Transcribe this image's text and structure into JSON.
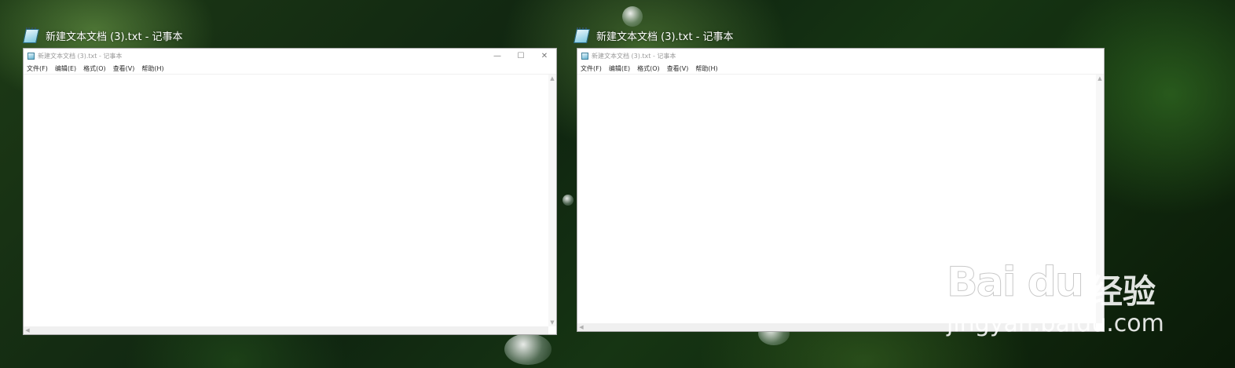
{
  "thumbnails": [
    {
      "title": "新建文本文档 (3).txt - 记事本"
    },
    {
      "title": "新建文本文档 (3).txt - 记事本"
    }
  ],
  "windows": [
    {
      "title": "新建文本文档 (3).txt - 记事本",
      "controls": {
        "minimize": "—",
        "maximize": "☐",
        "close": "✕"
      },
      "menu": [
        "文件(F)",
        "编辑(E)",
        "格式(O)",
        "查看(V)",
        "帮助(H)"
      ]
    },
    {
      "title": "新建文本文档 (3).txt - 记事本",
      "menu": [
        "文件(F)",
        "编辑(E)",
        "格式(O)",
        "查看(V)",
        "帮助(H)"
      ]
    }
  ],
  "watermark": {
    "brand": "Bai du",
    "chinese": "经验",
    "url": "jingyan.baidu.com"
  }
}
